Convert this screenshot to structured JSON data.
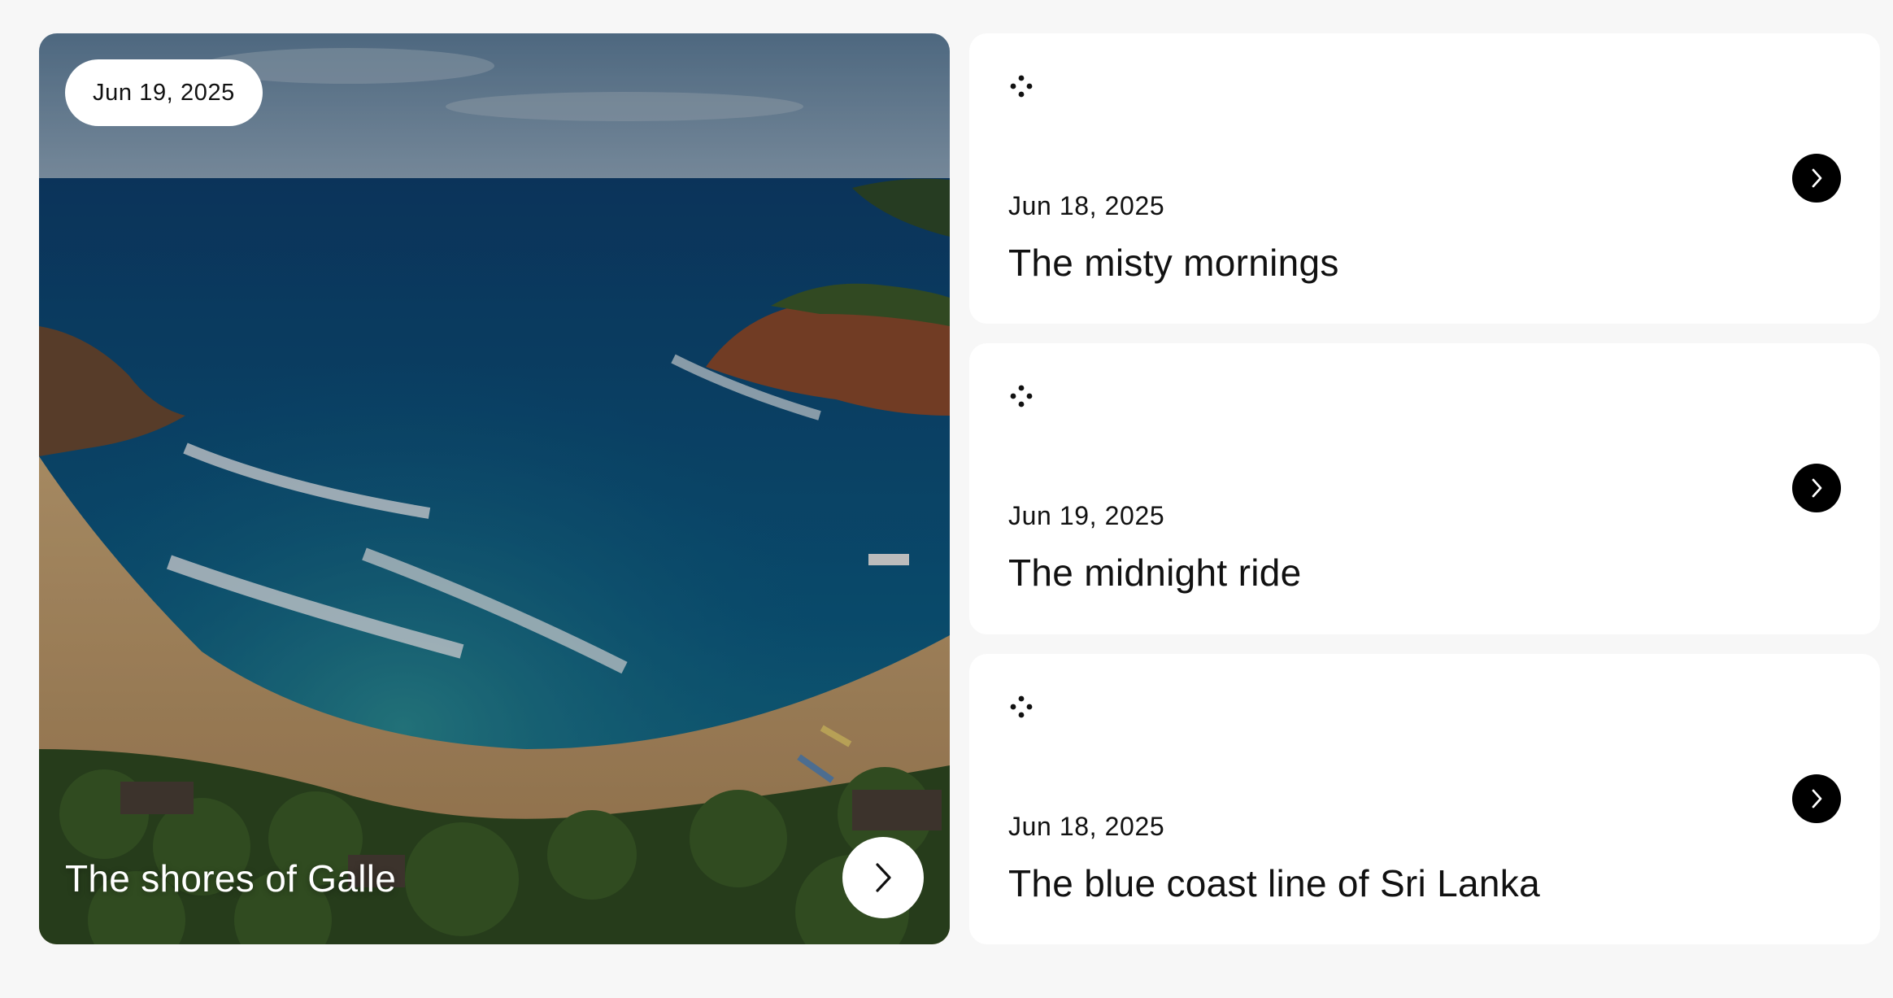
{
  "featured": {
    "date": "Jun 19, 2025",
    "title": "The shores of Galle",
    "next_icon": "chevron-right-icon"
  },
  "posts": [
    {
      "date": "Jun 18, 2025",
      "title": "The misty mornings",
      "icon": "dots-icon",
      "next_icon": "chevron-right-icon"
    },
    {
      "date": "Jun 19, 2025",
      "title": "The midnight ride",
      "icon": "dots-icon",
      "next_icon": "chevron-right-icon"
    },
    {
      "date": "Jun 18, 2025",
      "title": "The blue coast line of Sri Lanka",
      "icon": "dots-icon",
      "next_icon": "chevron-right-icon"
    }
  ],
  "colors": {
    "page_bg": "#f7f7f7",
    "card_bg": "#ffffff",
    "button_dark": "#000000",
    "text": "#111111"
  }
}
